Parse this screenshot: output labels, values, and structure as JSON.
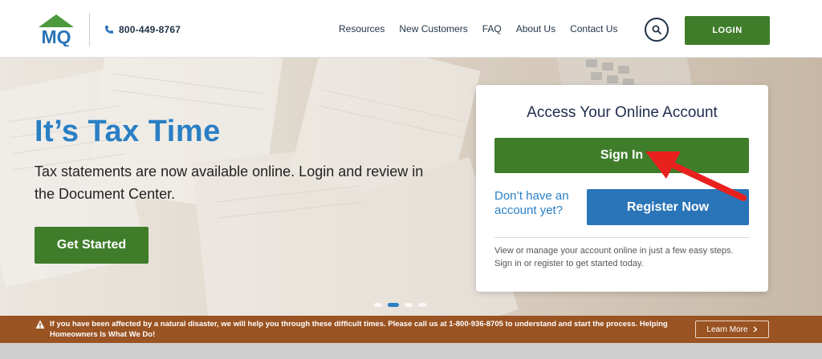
{
  "header": {
    "logo_text": "MQ",
    "phone": "800-449-8767",
    "nav": [
      "Resources",
      "New Customers",
      "FAQ",
      "About Us",
      "Contact Us"
    ],
    "login_label": "LOGIN"
  },
  "hero": {
    "title": "It’s Tax Time",
    "text": "Tax statements are now available online. Login and review in the Document Center.",
    "cta_label": "Get Started"
  },
  "account_card": {
    "title": "Access Your Online Account",
    "sign_in_label": "Sign In",
    "no_account_text": "Don’t have an account yet?",
    "register_label": "Register Now",
    "note": "View or manage your account online in just a few easy steps. Sign in or register to get started today."
  },
  "alert": {
    "text": "If you have been affected by a natural disaster, we will help you through these difficult times. Please call us at 1-800-936-8705 to understand and start the process. Helping Homeowners Is What We Do!",
    "learn_more_label": "Learn More"
  },
  "colors": {
    "brand_green": "#3f7d2b",
    "brand_blue": "#2a7fc4",
    "alert_brown": "#9a5322",
    "arrow_red": "#e8211e"
  }
}
